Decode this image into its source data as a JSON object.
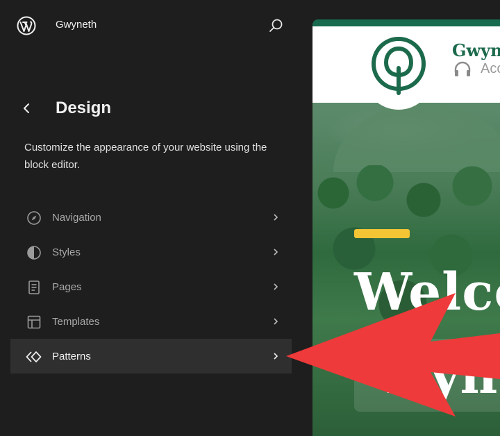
{
  "topbar": {
    "site_name": "Gwyneth",
    "logo_icon": "wordpress-icon",
    "search_icon": "search-icon"
  },
  "header": {
    "back_icon": "chevron-left-icon",
    "title": "Design",
    "description": "Customize the appearance of your website using the block editor."
  },
  "nav": {
    "items": [
      {
        "label": "Navigation",
        "icon": "compass-icon",
        "active": false
      },
      {
        "label": "Styles",
        "icon": "half-circle-icon",
        "active": false
      },
      {
        "label": "Pages",
        "icon": "page-icon",
        "active": false
      },
      {
        "label": "Templates",
        "icon": "layout-icon",
        "active": false
      },
      {
        "label": "Patterns",
        "icon": "diamond-icon",
        "active": true
      }
    ]
  },
  "preview": {
    "site_title": "Gwyn",
    "tagline": "Acc",
    "hero_line1": "Welco",
    "hero_line2": "Wyn"
  },
  "colors": {
    "sidebar_bg": "#1e1e1e",
    "active_bg": "#2f2f2f",
    "brand_green": "#186b4e",
    "accent_yellow": "#f3c535",
    "annotation_arrow": "#ee3a3a"
  }
}
